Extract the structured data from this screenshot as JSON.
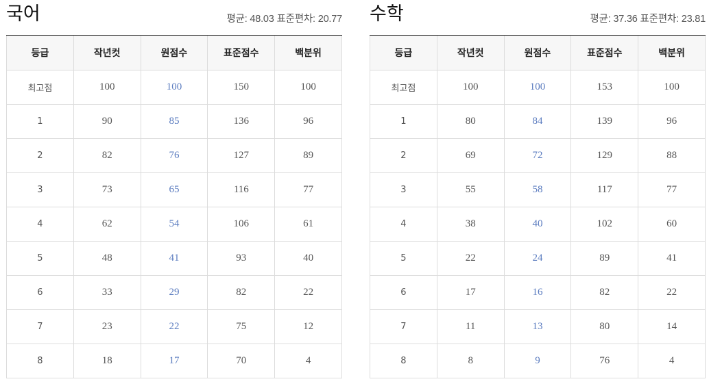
{
  "columns": [
    "등급",
    "작년컷",
    "원점수",
    "표준점수",
    "백분위"
  ],
  "subjects": [
    {
      "title": "국어",
      "stats": "평균: 48.03 표준편차: 20.77",
      "rows": [
        [
          "최고점",
          "100",
          "100",
          "150",
          "100"
        ],
        [
          "1",
          "90",
          "85",
          "136",
          "96"
        ],
        [
          "2",
          "82",
          "76",
          "127",
          "89"
        ],
        [
          "3",
          "73",
          "65",
          "116",
          "77"
        ],
        [
          "4",
          "62",
          "54",
          "106",
          "61"
        ],
        [
          "5",
          "48",
          "41",
          "93",
          "40"
        ],
        [
          "6",
          "33",
          "29",
          "82",
          "22"
        ],
        [
          "7",
          "23",
          "22",
          "75",
          "12"
        ],
        [
          "8",
          "18",
          "17",
          "70",
          "4"
        ]
      ]
    },
    {
      "title": "수학",
      "stats": "평균: 37.36 표준편차: 23.81",
      "rows": [
        [
          "최고점",
          "100",
          "100",
          "153",
          "100"
        ],
        [
          "1",
          "80",
          "84",
          "139",
          "96"
        ],
        [
          "2",
          "69",
          "72",
          "129",
          "88"
        ],
        [
          "3",
          "55",
          "58",
          "117",
          "77"
        ],
        [
          "4",
          "38",
          "40",
          "102",
          "60"
        ],
        [
          "5",
          "22",
          "24",
          "89",
          "41"
        ],
        [
          "6",
          "17",
          "16",
          "82",
          "22"
        ],
        [
          "7",
          "11",
          "13",
          "80",
          "14"
        ],
        [
          "8",
          "8",
          "9",
          "76",
          "4"
        ]
      ]
    }
  ],
  "colors": {
    "raw_score_text": "#5a7bbf",
    "header_bg": "#f7f7f7",
    "grid_line": "#dcdcdc"
  }
}
